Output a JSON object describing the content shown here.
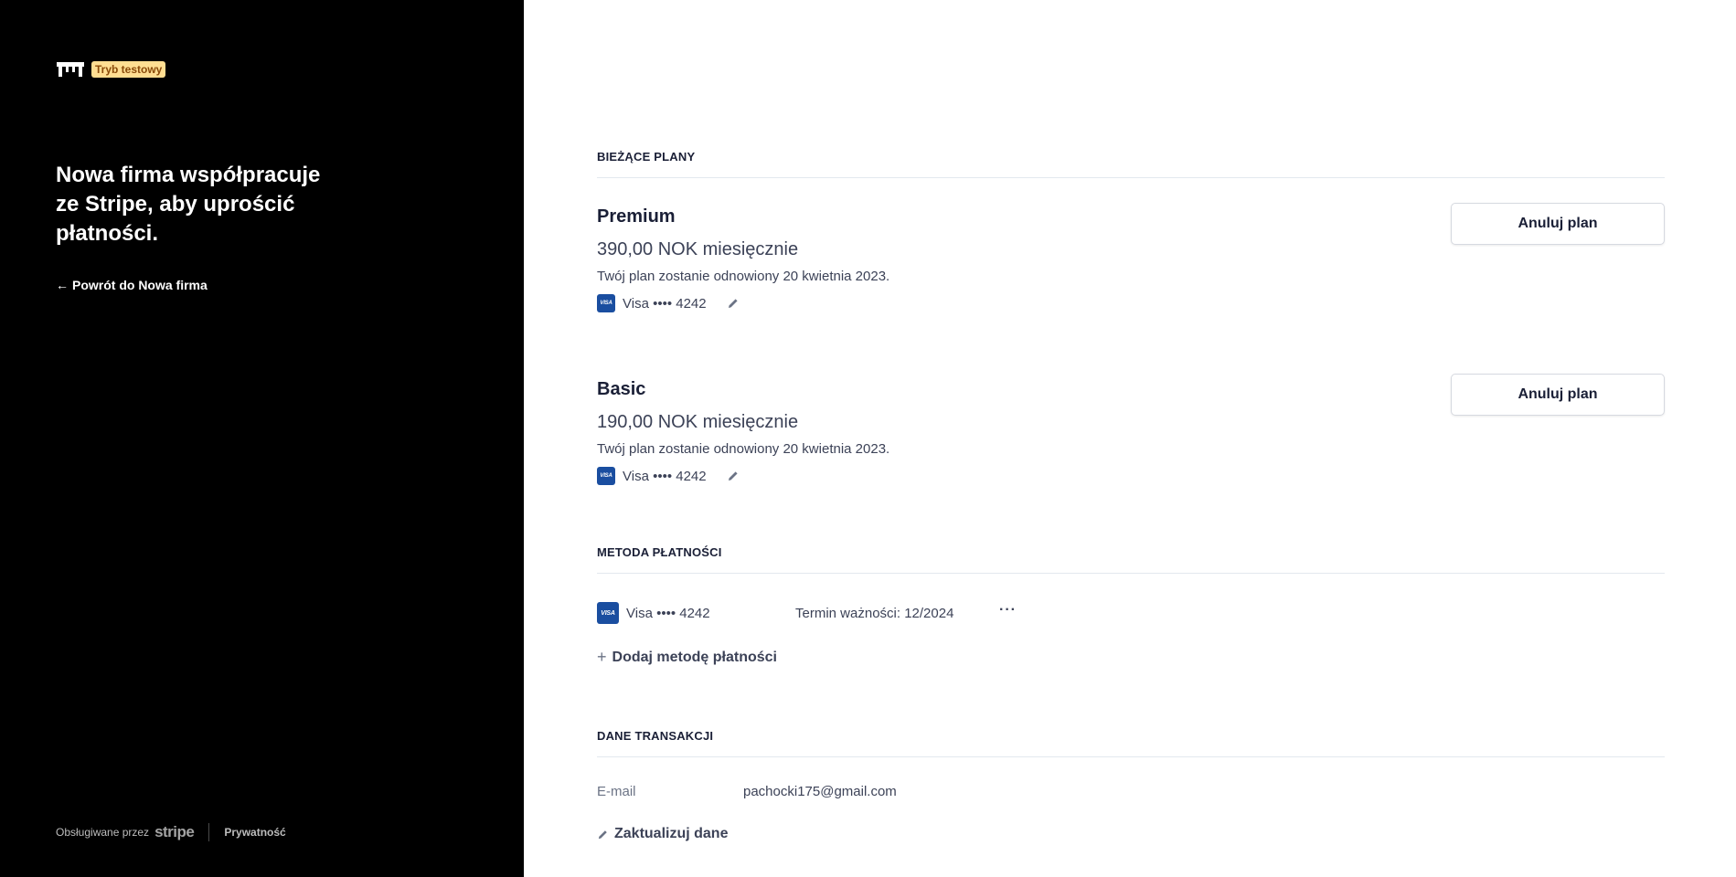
{
  "sidebar": {
    "test_badge": "Tryb testowy",
    "headline": "Nowa firma współpracuje ze Stripe, aby uprościć płatności.",
    "back_link": "Powrót do Nowa firma",
    "footer": {
      "powered_by": "Obsługiwane przez",
      "stripe_wordmark": "stripe",
      "privacy": "Prywatność"
    }
  },
  "current_plans": {
    "header": "BIEŻĄCE PLANY",
    "plans": [
      {
        "name": "Premium",
        "price": "390,00 NOK miesięcznie",
        "renewal": "Twój plan zostanie odnowiony 20 kwietnia 2023.",
        "card": "Visa •••• 4242",
        "cancel_label": "Anuluj plan"
      },
      {
        "name": "Basic",
        "price": "190,00 NOK miesięcznie",
        "renewal": "Twój plan zostanie odnowiony 20 kwietnia 2023.",
        "card": "Visa •••• 4242",
        "cancel_label": "Anuluj plan"
      }
    ]
  },
  "payment_method": {
    "header": "METODA PŁATNOŚCI",
    "card": "Visa •••• 4242",
    "expiry": "Termin ważności: 12/2024",
    "more": "···",
    "add_label": "Dodaj metodę płatności"
  },
  "transaction_data": {
    "header": "DANE TRANSAKCJI",
    "email_label": "E-mail",
    "email_value": "pachocki175@gmail.com",
    "update_label": "Zaktualizuj dane"
  },
  "icons": {
    "brand_logo": "store-icon",
    "visa": "visa-card-icon",
    "edit": "pencil-icon",
    "back": "arrow-left-icon",
    "add": "plus-icon"
  },
  "colors": {
    "sidebar_bg": "#000000",
    "badge_bg": "#ffde92",
    "visa_blue": "#1a4ea0",
    "text_primary": "#1a1f36"
  }
}
